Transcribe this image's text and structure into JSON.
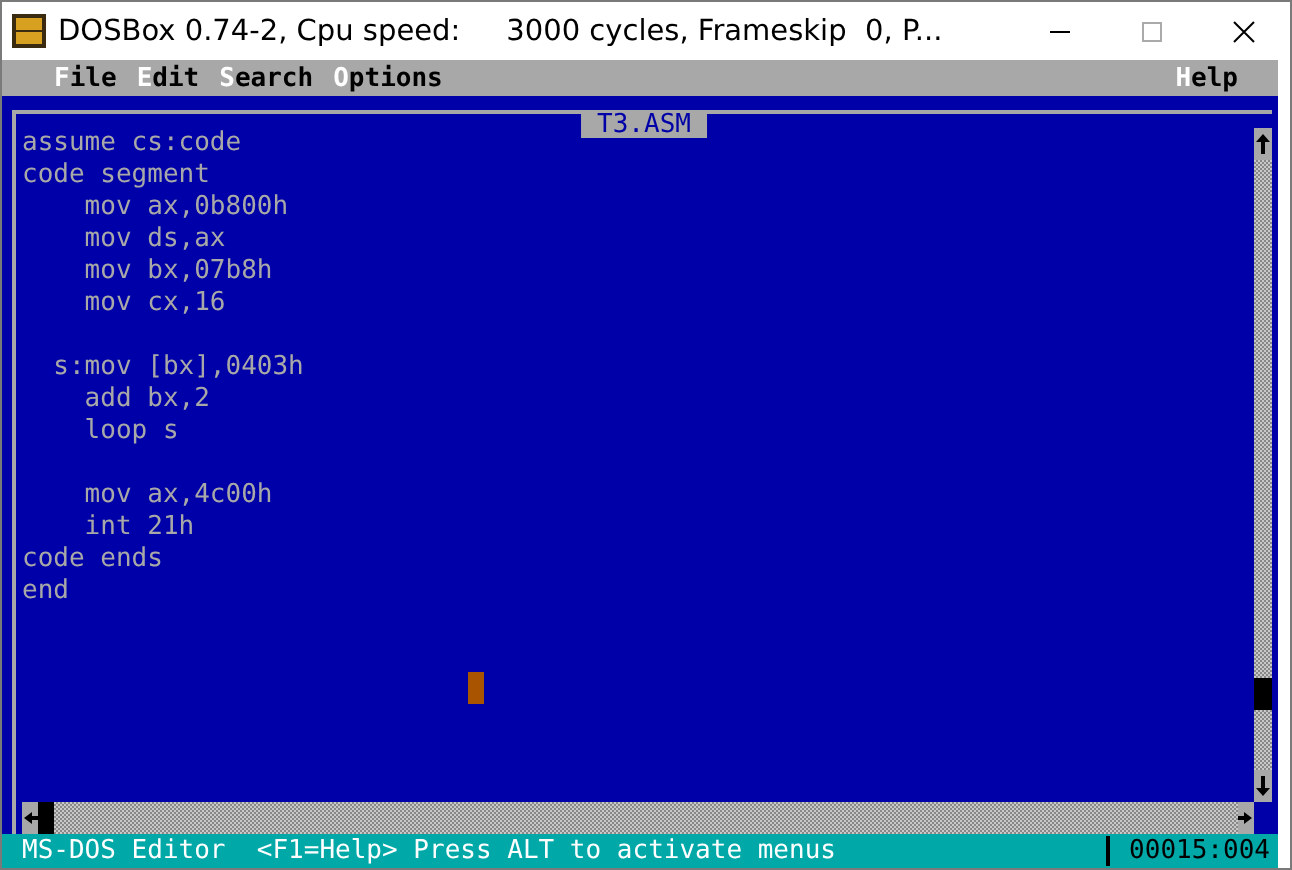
{
  "window": {
    "title": "DOSBox 0.74-2, Cpu speed:     3000 cycles, Frameskip  0, P..."
  },
  "menus": [
    {
      "label": "File"
    },
    {
      "label": "Edit"
    },
    {
      "label": "Search"
    },
    {
      "label": "Options"
    }
  ],
  "help_menu": {
    "label": "Help"
  },
  "editor": {
    "title": "T3.ASM",
    "blocks": [
      [
        "assume cs:code",
        "code segment",
        "    mov ax,0b800h",
        "    mov ds,ax",
        "    mov bx,07b8h",
        "    mov cx,16"
      ],
      [
        "  s:mov [bx],0403h",
        "    add bx,2",
        "    loop s"
      ],
      [
        "    mov ax,4c00h",
        "    int 21h",
        "code ends",
        "end"
      ]
    ]
  },
  "status_bar": {
    "message": "MS-DOS Editor  <F1=Help> Press ALT to activate menus",
    "position": "00015:004"
  }
}
